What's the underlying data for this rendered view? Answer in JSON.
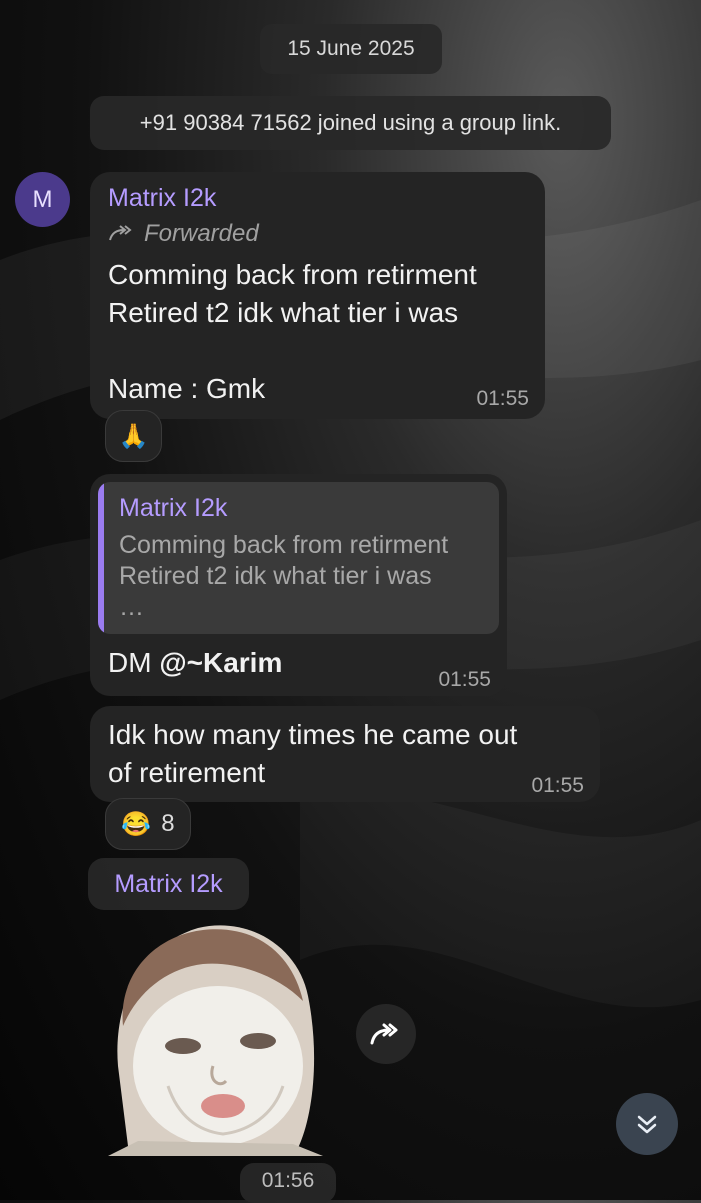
{
  "date_separator": "15 June 2025",
  "service_message": "+91 90384 71562 joined using a group link.",
  "avatar_letter": "M",
  "message1": {
    "sender": "Matrix I2k",
    "forwarded_label": "Forwarded",
    "text": "Comming back from retirment\nRetired t2 idk what tier i was\n\nName : Gmk",
    "time": "01:55",
    "reaction_emoji": "🙏"
  },
  "message2": {
    "quote_sender": "Matrix I2k",
    "quote_text": "Comming back from retirment\nRetired t2 idk what tier i was\n…",
    "text_prefix": "DM ",
    "mention": "@~Karim",
    "time": "01:55"
  },
  "message3": {
    "text": "Idk how many times he came out\nof retirement",
    "time": "01:55",
    "reaction_emoji": "😂",
    "reaction_count": "8"
  },
  "sticker_message": {
    "sender": "Matrix I2k",
    "time": "01:56"
  },
  "colors": {
    "accent": "#b59cff",
    "bubble": "#242424",
    "avatar": "#4b3a8c"
  }
}
